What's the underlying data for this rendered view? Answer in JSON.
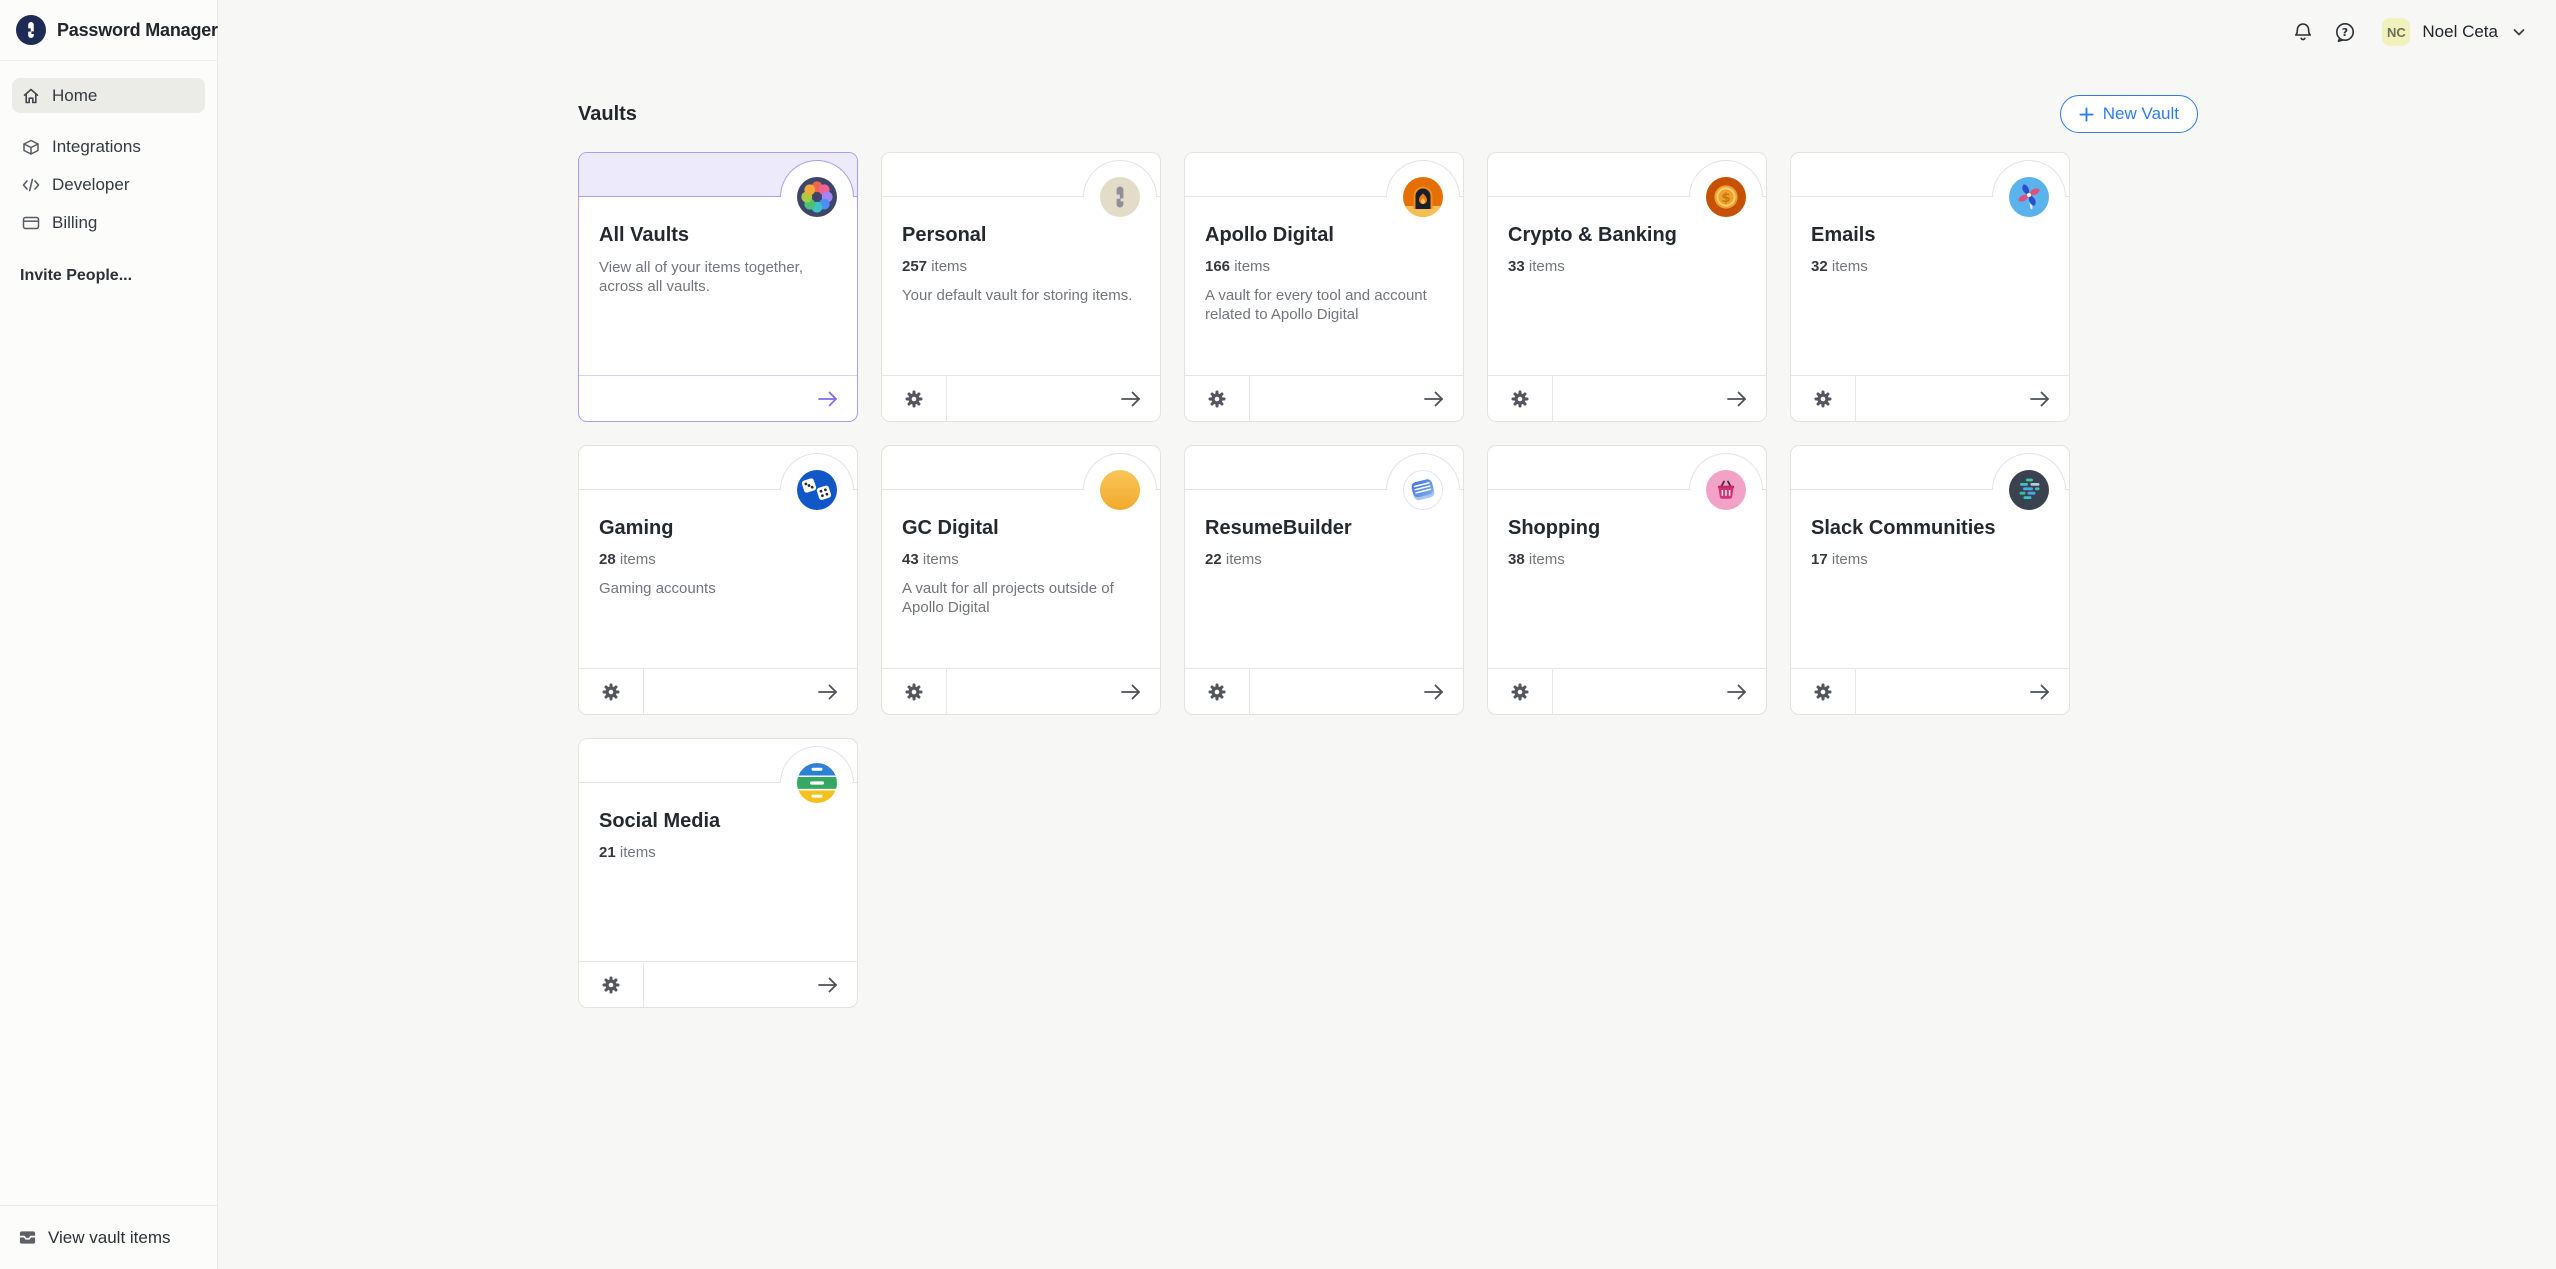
{
  "app": {
    "title": "Password Manager"
  },
  "sidebar": {
    "items": [
      {
        "label": "Home",
        "icon": "home-icon",
        "active": true
      },
      {
        "label": "Integrations",
        "icon": "integrations-icon",
        "active": false
      },
      {
        "label": "Developer",
        "icon": "developer-icon",
        "active": false
      },
      {
        "label": "Billing",
        "icon": "billing-icon",
        "active": false
      }
    ],
    "invite_label": "Invite People...",
    "footer_label": "View vault items"
  },
  "topbar": {
    "avatar_initials": "NC",
    "user_name": "Noel Ceta"
  },
  "main": {
    "heading": "Vaults",
    "new_vault_label": "New Vault"
  },
  "labels": {
    "items_suffix": "items"
  },
  "vaults": [
    {
      "name": "All Vaults",
      "items_count": null,
      "desc": "View all of your items together, across all vaults.",
      "icon": "all-vaults",
      "special": true
    },
    {
      "name": "Personal",
      "items_count": "257",
      "desc": "Your default vault for storing items.",
      "icon": "personal",
      "special": false
    },
    {
      "name": "Apollo Digital",
      "items_count": "166",
      "desc": "A vault for every tool and account related to Apollo Digital",
      "icon": "apollo",
      "special": false
    },
    {
      "name": "Crypto & Banking",
      "items_count": "33",
      "desc": "",
      "icon": "crypto",
      "special": false
    },
    {
      "name": "Emails",
      "items_count": "32",
      "desc": "",
      "icon": "emails",
      "special": false
    },
    {
      "name": "Gaming",
      "items_count": "28",
      "desc": "Gaming accounts",
      "icon": "gaming",
      "special": false
    },
    {
      "name": "GC Digital",
      "items_count": "43",
      "desc": "A vault for all projects outside of Apollo Digital",
      "icon": "gc-digital",
      "special": false
    },
    {
      "name": "ResumeBuilder",
      "items_count": "22",
      "desc": "",
      "icon": "resumebuilder",
      "special": false
    },
    {
      "name": "Shopping",
      "items_count": "38",
      "desc": "",
      "icon": "shopping",
      "special": false
    },
    {
      "name": "Slack Communities",
      "items_count": "17",
      "desc": "",
      "icon": "slack",
      "special": false
    },
    {
      "name": "Social Media",
      "items_count": "21",
      "desc": "",
      "icon": "social-media",
      "special": false
    }
  ],
  "colors": {
    "accent_blue": "#2e7cf0",
    "special_purple": "#a89ef2",
    "special_strip": "#edeafc",
    "card_border": "#e3e3e0",
    "page_bg": "#f7f7f5",
    "avatar_bg": "#f0f1bd"
  }
}
